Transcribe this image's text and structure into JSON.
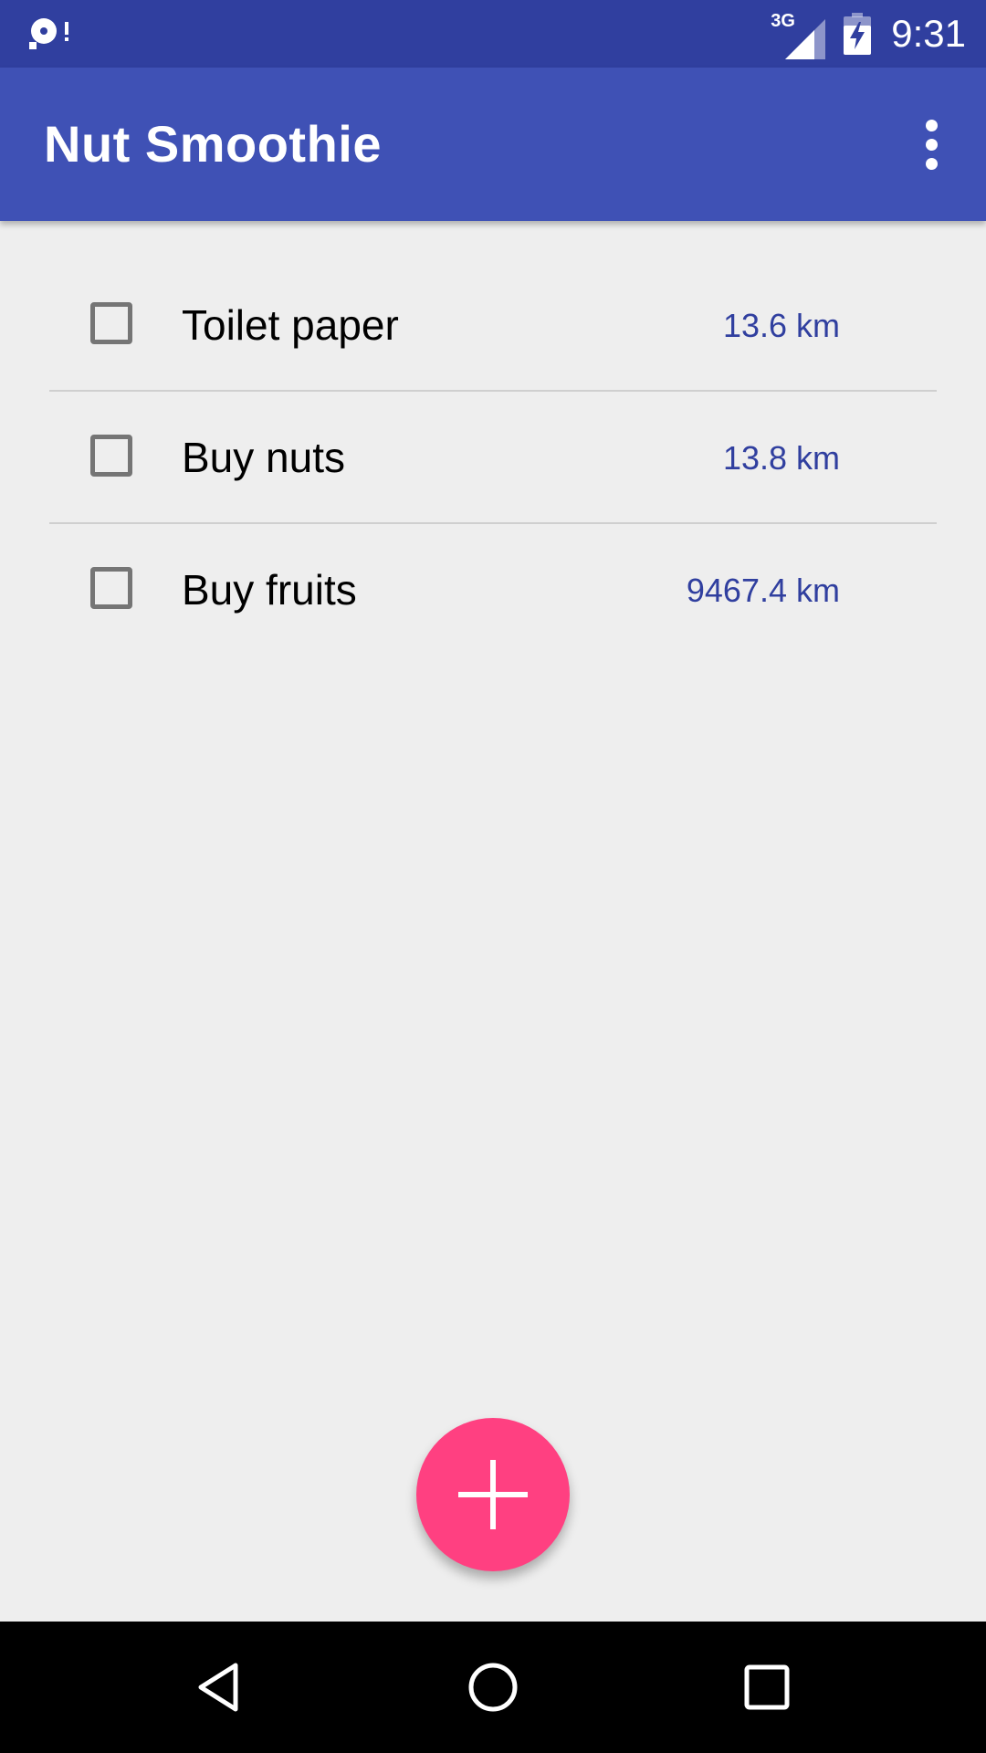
{
  "status_bar": {
    "network_label": "3G",
    "time": "9:31",
    "left_icon": "notification-icon",
    "signal_icon": "signal-icon",
    "battery_icon": "battery-charging-icon"
  },
  "app_bar": {
    "title": "Nut Smoothie",
    "overflow_icon": "more-vert-icon"
  },
  "list": {
    "items": [
      {
        "label": "Toilet paper",
        "distance": "13.6 km",
        "checked": false
      },
      {
        "label": "Buy nuts",
        "distance": "13.8 km",
        "checked": false
      },
      {
        "label": "Buy fruits",
        "distance": "9467.4 km",
        "checked": false
      }
    ]
  },
  "fab": {
    "icon": "add-icon"
  },
  "nav_bar": {
    "back_icon": "back-icon",
    "home_icon": "home-icon",
    "recents_icon": "recents-icon"
  },
  "colors": {
    "primary": "#3F51B5",
    "primary_dark": "#303F9F",
    "accent": "#FF4081",
    "background": "#EEEEEE",
    "distance_text": "#303F9F"
  }
}
